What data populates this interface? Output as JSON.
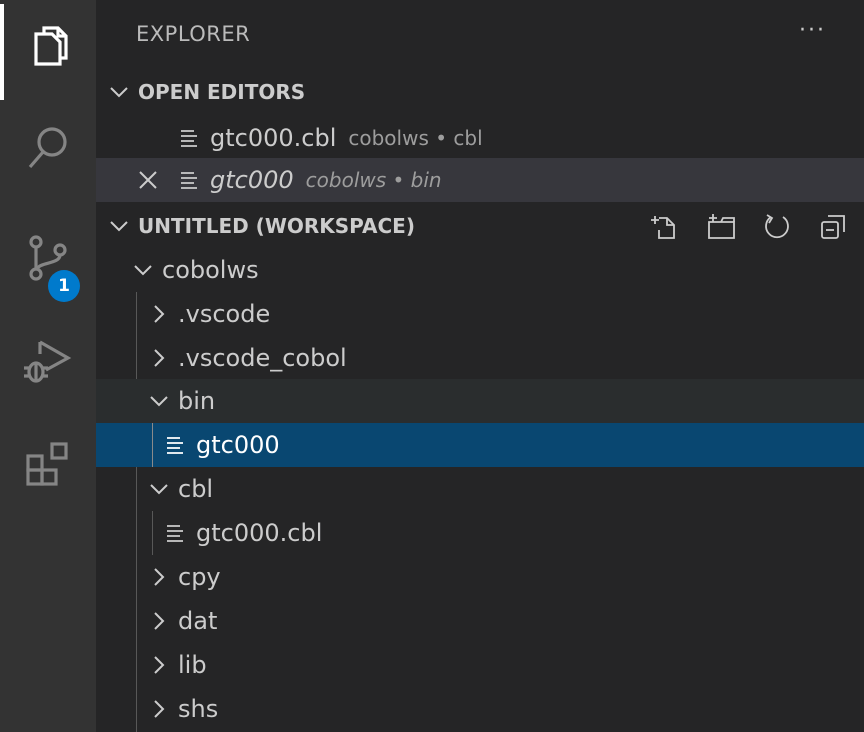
{
  "sidebar": {
    "title": "EXPLORER",
    "more_actions": "···"
  },
  "activity": {
    "scm_badge": "1",
    "items": [
      "files-icon",
      "search-icon",
      "source-control-icon",
      "run-debug-icon",
      "extensions-icon"
    ]
  },
  "open_editors": {
    "label": "OPEN EDITORS",
    "items": [
      {
        "name": "gtc000.cbl",
        "description": "cobolws • cbl"
      },
      {
        "name": "gtc000",
        "description": "cobolws • bin"
      }
    ]
  },
  "workspace": {
    "label": "UNTITLED (WORKSPACE)",
    "root": "cobolws",
    "tree": [
      {
        "name": ".vscode",
        "type": "folder",
        "expanded": false
      },
      {
        "name": ".vscode_cobol",
        "type": "folder",
        "expanded": false
      },
      {
        "name": "bin",
        "type": "folder",
        "expanded": true
      },
      {
        "name": "gtc000",
        "type": "file"
      },
      {
        "name": "cbl",
        "type": "folder",
        "expanded": true
      },
      {
        "name": "gtc000.cbl",
        "type": "file"
      },
      {
        "name": "cpy",
        "type": "folder",
        "expanded": false
      },
      {
        "name": "dat",
        "type": "folder",
        "expanded": false
      },
      {
        "name": "lib",
        "type": "folder",
        "expanded": false
      },
      {
        "name": "shs",
        "type": "folder",
        "expanded": false
      }
    ]
  },
  "colors": {
    "activity_bar": "#333333",
    "sidebar": "#252526",
    "selection": "#094771",
    "badge": "#007acc"
  }
}
